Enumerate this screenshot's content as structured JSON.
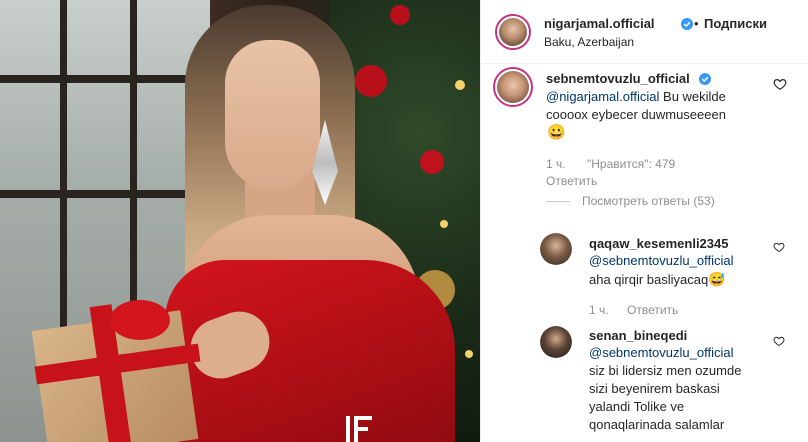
{
  "post": {
    "author": "nigarjamal.official",
    "follow_label": "Подписки",
    "location": "Baku, Azerbaijan",
    "separator": "•"
  },
  "comments": [
    {
      "username": "sebnemtovuzlu_official",
      "verified": true,
      "mention": "@nigarjamal.official",
      "text": " Bu wekilde coooox eybecer duwmuseeeen",
      "emoji": "😀",
      "time": "1 ч.",
      "likes": "\"Нравится\": 479",
      "reply_label": "Ответить",
      "view_replies": "Посмотреть ответы (53)"
    }
  ],
  "replies": [
    {
      "username": "qaqaw_kesemenli2345",
      "mention": "@sebnemtovuzlu_official",
      "text": "aha qirqir basliyacaq",
      "emoji": "😅",
      "time": "1 ч.",
      "reply_label": "Ответить"
    },
    {
      "username": "senan_bineqedi",
      "mention": "@sebnemtovuzlu_official",
      "lines": [
        "siz bi lidersiz men ozumde",
        "sizi beyenirem baskasi",
        "yalandi Tolike ve",
        "qonaqlarinada salamlar"
      ]
    }
  ],
  "icons": {
    "verified": "verified-badge-icon",
    "heart": "heart-outline-icon"
  },
  "colors": {
    "verified_blue": "#3897f0",
    "mention_blue": "#00376b",
    "muted_gray": "#8e8e8e",
    "story_ring": "#c13584"
  }
}
